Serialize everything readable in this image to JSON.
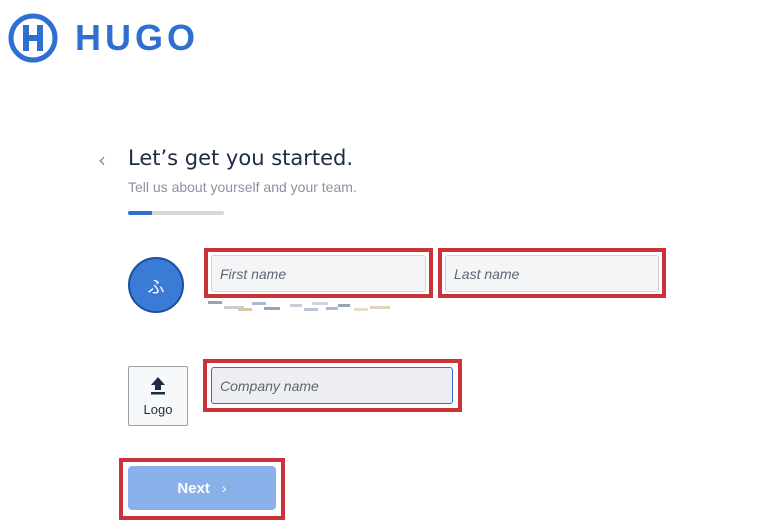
{
  "brand": {
    "name": "HUGO",
    "color": "#2f6fd1"
  },
  "header": {
    "back_icon": "chevron-left-icon",
    "back_glyph": "‹",
    "title": "Let’s get you started.",
    "subtitle": "Tell us about yourself and your team."
  },
  "progress": {
    "step_fraction": 0.25
  },
  "avatar": {
    "initials": "ふ",
    "color": "#3a7bd5"
  },
  "form": {
    "first_name_placeholder": "First name",
    "first_name_value": "",
    "last_name_placeholder": "Last name",
    "last_name_value": "",
    "company_name_placeholder": "Company name",
    "company_name_value": "",
    "upload_label": "Logo",
    "upload_icon": "upload-icon"
  },
  "actions": {
    "next_label": "Next",
    "next_icon": "chevron-right-icon",
    "next_glyph": "›"
  },
  "colors": {
    "highlight": "#c8343a",
    "next_button": "#8ab0ea",
    "text": "#1d2b45",
    "muted": "#8a92a0"
  }
}
